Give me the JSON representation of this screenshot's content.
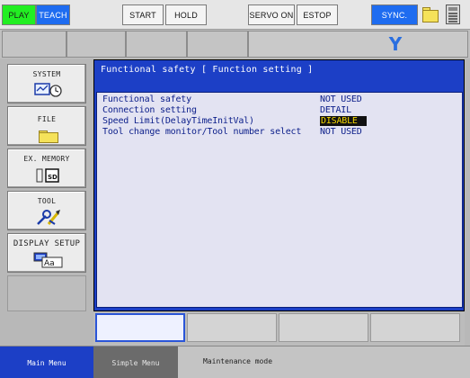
{
  "toolbar": {
    "play": "PLAY",
    "teach": "TEACH",
    "start": "START",
    "hold": "HOLD",
    "servo_on": "SERVO ON",
    "estop": "ESTOP",
    "sync": "SYNC.",
    "folder_icon": "folder-icon",
    "calculator_icon": "calculator-icon"
  },
  "jog": {
    "axis_label": "Y"
  },
  "left_menu": {
    "items": [
      {
        "label": "SYSTEM",
        "icon": "system-monitor-icon"
      },
      {
        "label": "FILE",
        "icon": "folder-icon"
      },
      {
        "label": "EX. MEMORY",
        "icon": "sd-card-icon"
      },
      {
        "label": "TOOL",
        "icon": "tool-icon"
      },
      {
        "label": "DISPLAY SETUP",
        "icon": "display-font-icon"
      }
    ]
  },
  "content": {
    "title": "Functional safety [ Function setting ]",
    "rows": [
      {
        "label": "Functional safety",
        "value": "NOT USED"
      },
      {
        "label": "Connection setting",
        "value": "DETAIL"
      },
      {
        "label": "Speed Limit(DelayTimeInitVal)",
        "value": "DISABLE"
      },
      {
        "label": "Tool change monitor/Tool number select",
        "value": "NOT USED"
      }
    ]
  },
  "status": {
    "main_menu": "Main Menu",
    "simple_menu": "Simple Menu",
    "mode": "Maintenance mode"
  },
  "colors": {
    "play_bg": "#22ee22",
    "teach_bg": "#1e6cf0",
    "content_bg": "#1c3fc6",
    "panel_bg": "#e3e3f2",
    "selected_bg": "#111111",
    "selected_text": "#f5d800",
    "axis_label": "#2a6fe0"
  }
}
